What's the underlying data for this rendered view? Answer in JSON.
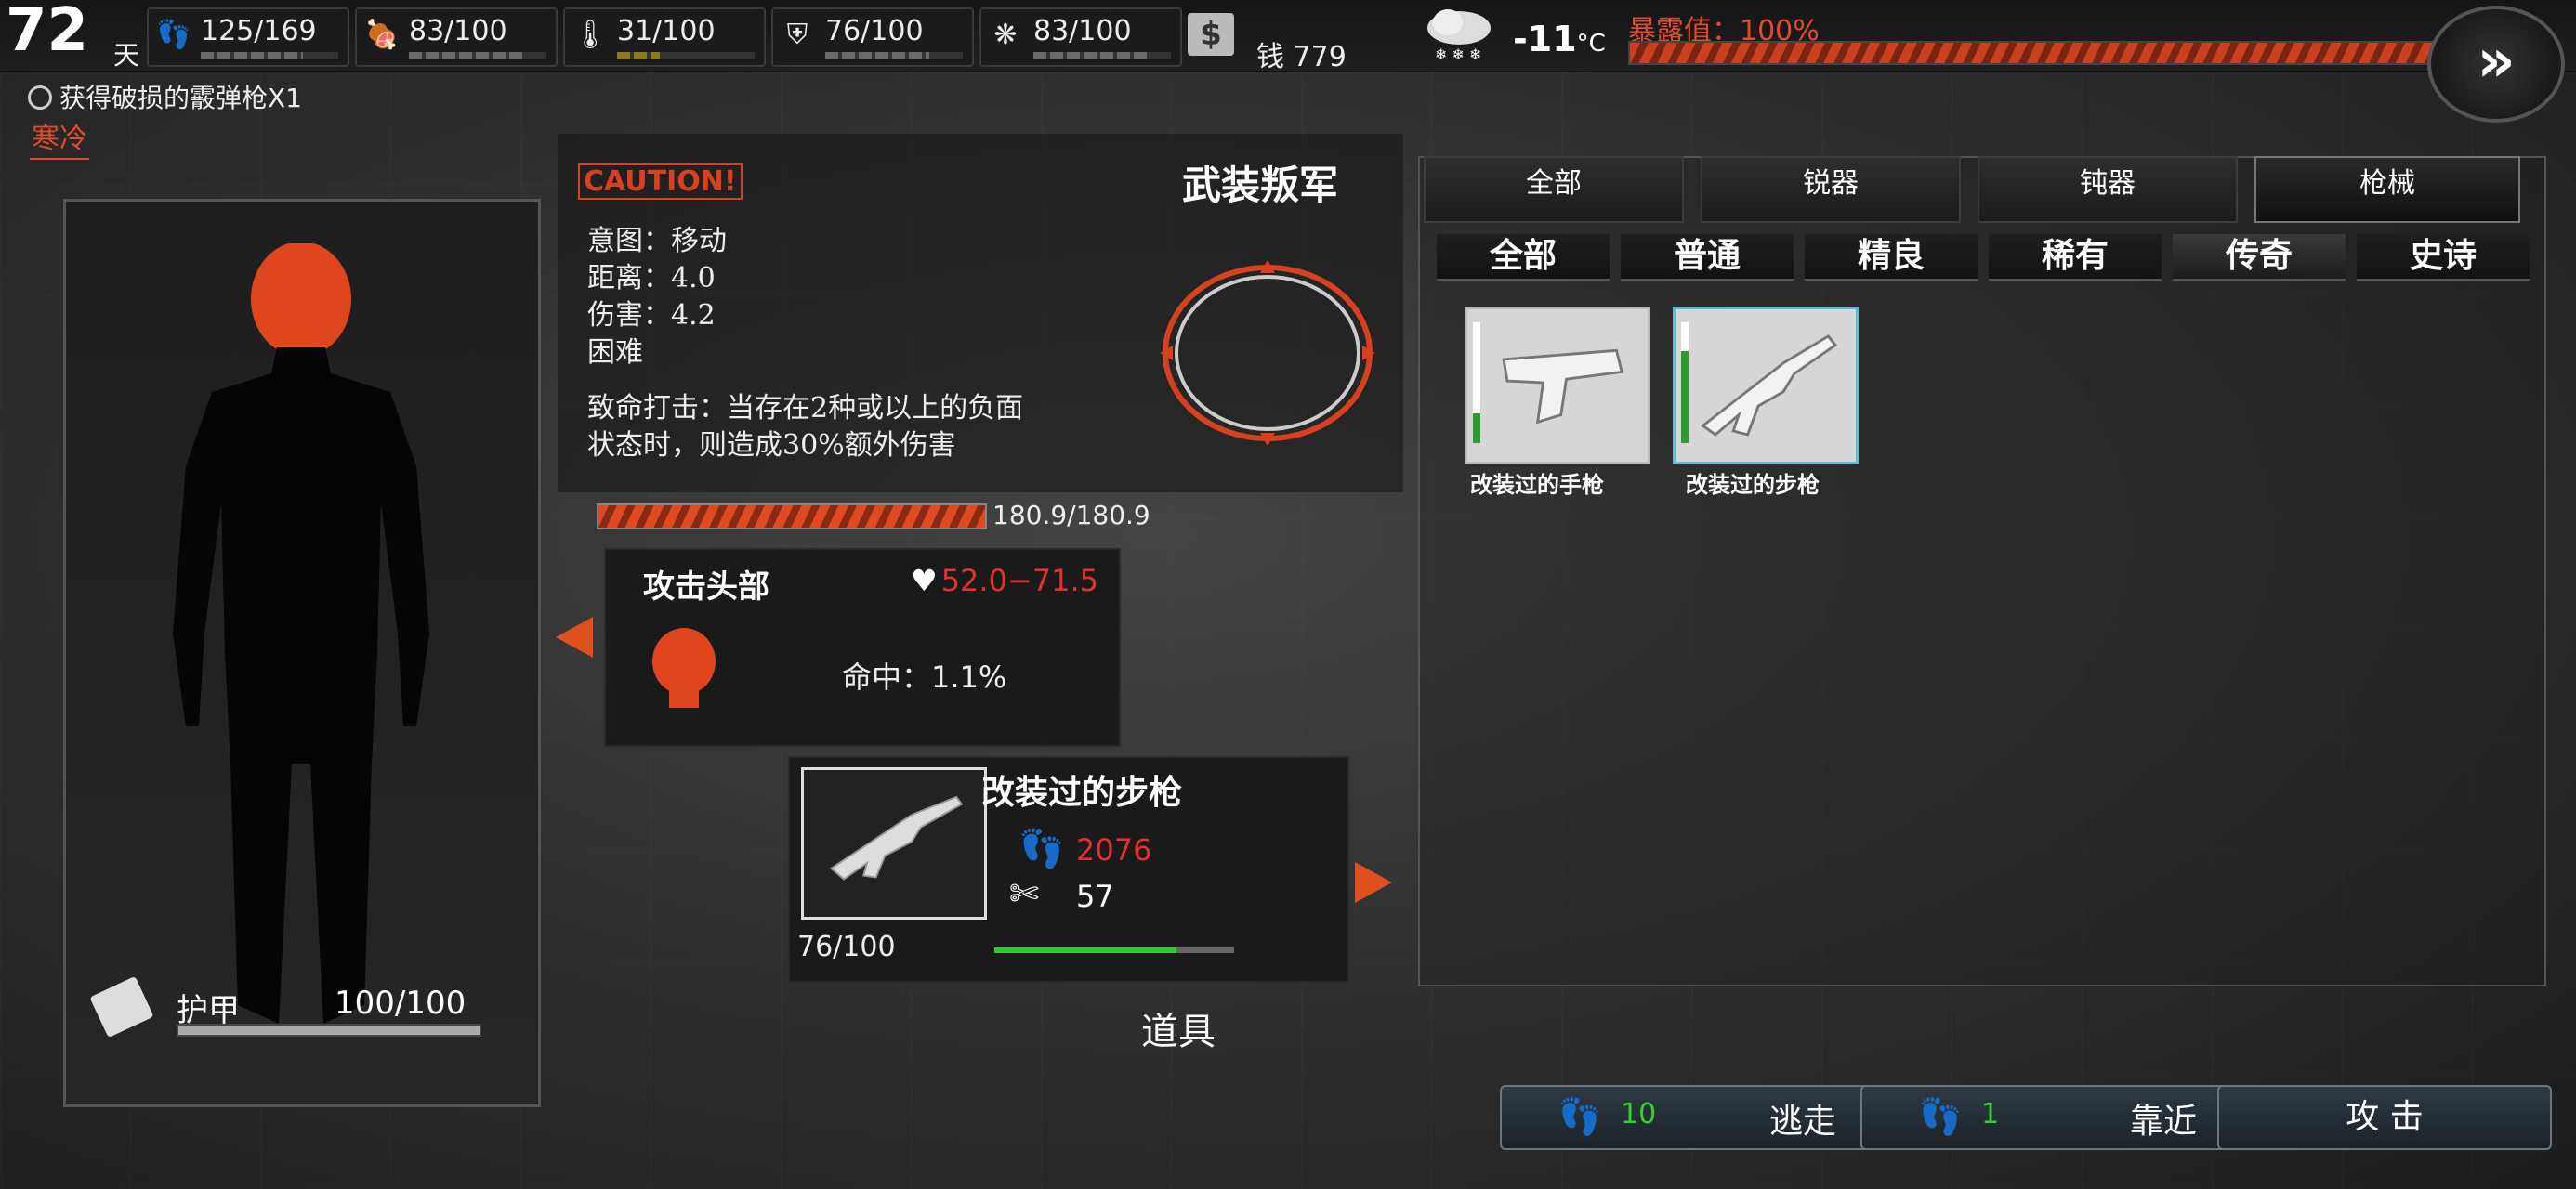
{
  "top": {
    "day": "72",
    "day_unit": "天",
    "stats": [
      {
        "icon": "footprints-icon",
        "value": "125/169",
        "fill": 0.74
      },
      {
        "icon": "meat-icon",
        "value": "83/100",
        "fill": 0.83
      },
      {
        "icon": "thermometer-icon",
        "value": "31/100",
        "fill": 0.31
      },
      {
        "icon": "health-shield-icon",
        "value": "76/100",
        "fill": 0.76
      },
      {
        "icon": "brain-icon",
        "value": "83/100",
        "fill": 0.83
      }
    ],
    "money_label": "钱 779",
    "temperature": "-11",
    "temp_unit": "°C",
    "exposure_label": "暴露值：100%",
    "exposure_fill": 1.0
  },
  "notice": "获得破损的霰弹枪X1",
  "status_cold": "寒冷",
  "armor": {
    "label": "护甲",
    "value": "100/100"
  },
  "enemy": {
    "caution": "CAUTION!",
    "name": "武装叛军",
    "intent": "意图：移动",
    "distance": "距离：4.0",
    "damage": "伤害：4.2",
    "difficulty": "困难",
    "crit_line1": "致命打击：当存在2种或以上的负面",
    "crit_line2": "状态时，则造成30%额外伤害",
    "hp_text": "180.9/180.9",
    "hp_fill": 1.0
  },
  "attack": {
    "title": "攻击头部",
    "damage": "52.0−71.5",
    "hit": "命中：1.1%"
  },
  "weapon": {
    "name": "改装过的步枪",
    "stat_steps": "2076",
    "stat_other": "57",
    "durability": "76/100",
    "durability_fill": 0.76
  },
  "props_label": "道具",
  "tabs_top": [
    "全部",
    "锐器",
    "钝器",
    "枪械"
  ],
  "tabs_top_active": 3,
  "tabs_rarity": [
    "全部",
    "普通",
    "精良",
    "稀有",
    "传奇",
    "史诗"
  ],
  "tabs_rarity_active": 4,
  "items": [
    {
      "name": "改装过的手枪",
      "dur_fill": 0.25
    },
    {
      "name": "改装过的步枪",
      "dur_fill": 0.76
    }
  ],
  "buttons": {
    "flee_count": "10",
    "flee": "逃走",
    "approach_count": "1",
    "approach": "靠近",
    "attack": "攻 击"
  },
  "colors": {
    "accent_red": "#e0501e",
    "hp_red": "#e03030",
    "ok_green": "#32c832"
  }
}
